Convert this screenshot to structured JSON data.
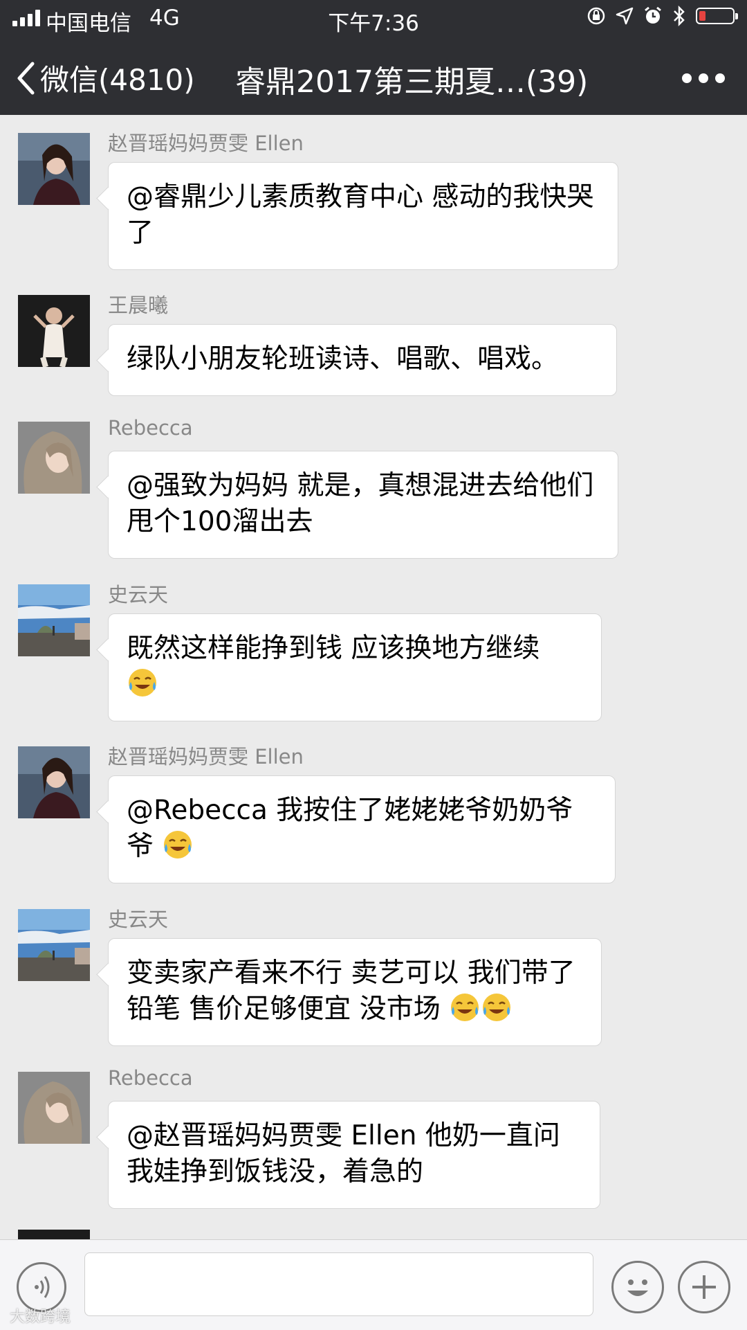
{
  "status_bar": {
    "carrier": "中国电信",
    "network": "4G",
    "time": "下午7:36"
  },
  "nav": {
    "back_label": "微信(4810)",
    "title": "睿鼎2017第三期夏…(39)"
  },
  "messages": [
    {
      "sender": "赵晋瑶妈妈贾雯 Ellen",
      "text": "@睿鼎少儿素质教育中心 感动的我快哭了"
    },
    {
      "sender": "王晨曦",
      "text": "绿队小朋友轮班读诗、唱歌、唱戏。"
    },
    {
      "sender": "Rebecca",
      "text": "@强致为妈妈 就是，真想混进去给他们甩个100溜出去"
    },
    {
      "sender": "史云天",
      "text": "既然这样能挣到钱 应该换地方继续"
    },
    {
      "sender": "赵晋瑶妈妈贾雯 Ellen",
      "text": "@Rebecca 我按住了姥姥姥爷奶奶爷爷"
    },
    {
      "sender": "史云天",
      "text": "变卖家产看来不行 卖艺可以 我们带了铅笔 售价足够便宜 没市场"
    },
    {
      "sender": "Rebecca",
      "text": "@赵晋瑶妈妈贾雯 Ellen 他奶一直问我娃挣到饭钱没，着急的"
    }
  ],
  "icons": {
    "emoji": "tears-of-joy-emoji",
    "voice": "voice-icon",
    "sticker": "emoji-smiley-icon",
    "add": "plus-icon",
    "more": "more-dots-icon",
    "back": "chevron-left-icon"
  },
  "colors": {
    "header_bg": "#2e2f33",
    "chat_bg": "#ebebeb",
    "battery_low": "#e64340"
  },
  "watermark": "大数跨境"
}
